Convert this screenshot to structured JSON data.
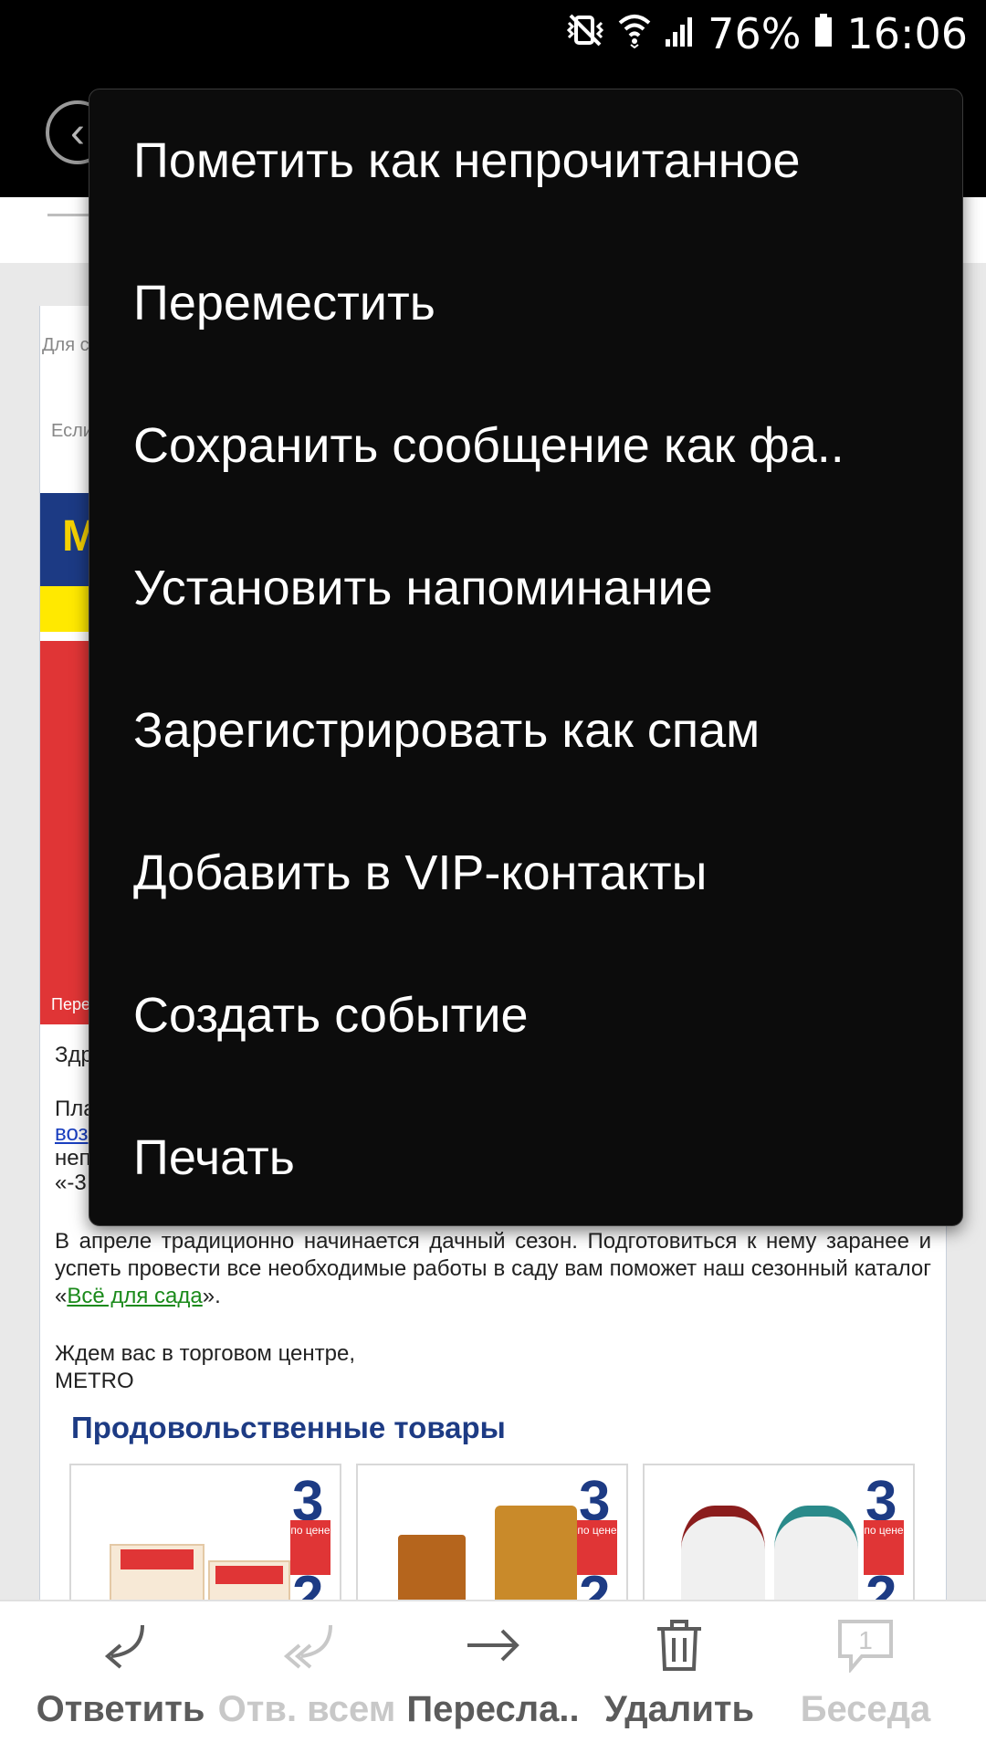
{
  "status_bar": {
    "battery": "76%",
    "time": "16:06",
    "icons": [
      "vibrate-mute-icon",
      "wifi-icon",
      "signal-icon",
      "battery-icon"
    ]
  },
  "email": {
    "fragments": {
      "line1": "Для с",
      "line2": "Если",
      "banner_text": "Пере",
      "greet": "Здр",
      "p1a": "Пла",
      "p1b": "воз",
      "p1c": "неп",
      "p1d": "«-3"
    },
    "paragraph": "В апреле традиционно начинается дачный сезон. Подготовиться к нему заранее и успеть провести все необходимые работы в саду вам поможет наш сезонный каталог «",
    "catalog_link": "Всё для сада",
    "paragraph_end": "».",
    "closing1": "Ждем вас в торговом центре,",
    "closing2": "METRO",
    "section_title": "Продовольственные товары",
    "promo": {
      "big": "3",
      "small": "2",
      "tag": "по цене"
    }
  },
  "menu": {
    "items": [
      "Пометить как непрочитанное",
      "Переместить",
      "Сохранить сообщение как фа..",
      "Установить напоминание",
      "Зарегистрировать как спам",
      "Добавить в VIP-контакты",
      "Создать событие",
      "Печать"
    ]
  },
  "toolbar": {
    "reply": "Ответить",
    "reply_all": "Отв. всем",
    "forward": "Пересла..",
    "delete": "Удалить",
    "conversation": "Беседа",
    "conversation_count": "1"
  }
}
